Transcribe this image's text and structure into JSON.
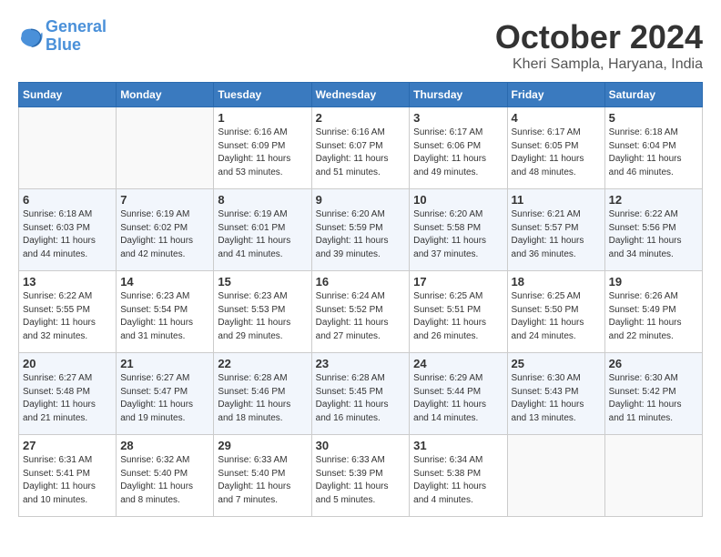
{
  "header": {
    "logo_line1": "General",
    "logo_line2": "Blue",
    "month_title": "October 2024",
    "location": "Kheri Sampla, Haryana, India"
  },
  "days_of_week": [
    "Sunday",
    "Monday",
    "Tuesday",
    "Wednesday",
    "Thursday",
    "Friday",
    "Saturday"
  ],
  "weeks": [
    [
      {
        "day": null
      },
      {
        "day": null
      },
      {
        "day": "1",
        "sunrise": "6:16 AM",
        "sunset": "6:09 PM",
        "daylight": "11 hours and 53 minutes."
      },
      {
        "day": "2",
        "sunrise": "6:16 AM",
        "sunset": "6:07 PM",
        "daylight": "11 hours and 51 minutes."
      },
      {
        "day": "3",
        "sunrise": "6:17 AM",
        "sunset": "6:06 PM",
        "daylight": "11 hours and 49 minutes."
      },
      {
        "day": "4",
        "sunrise": "6:17 AM",
        "sunset": "6:05 PM",
        "daylight": "11 hours and 48 minutes."
      },
      {
        "day": "5",
        "sunrise": "6:18 AM",
        "sunset": "6:04 PM",
        "daylight": "11 hours and 46 minutes."
      }
    ],
    [
      {
        "day": "6",
        "sunrise": "6:18 AM",
        "sunset": "6:03 PM",
        "daylight": "11 hours and 44 minutes."
      },
      {
        "day": "7",
        "sunrise": "6:19 AM",
        "sunset": "6:02 PM",
        "daylight": "11 hours and 42 minutes."
      },
      {
        "day": "8",
        "sunrise": "6:19 AM",
        "sunset": "6:01 PM",
        "daylight": "11 hours and 41 minutes."
      },
      {
        "day": "9",
        "sunrise": "6:20 AM",
        "sunset": "5:59 PM",
        "daylight": "11 hours and 39 minutes."
      },
      {
        "day": "10",
        "sunrise": "6:20 AM",
        "sunset": "5:58 PM",
        "daylight": "11 hours and 37 minutes."
      },
      {
        "day": "11",
        "sunrise": "6:21 AM",
        "sunset": "5:57 PM",
        "daylight": "11 hours and 36 minutes."
      },
      {
        "day": "12",
        "sunrise": "6:22 AM",
        "sunset": "5:56 PM",
        "daylight": "11 hours and 34 minutes."
      }
    ],
    [
      {
        "day": "13",
        "sunrise": "6:22 AM",
        "sunset": "5:55 PM",
        "daylight": "11 hours and 32 minutes."
      },
      {
        "day": "14",
        "sunrise": "6:23 AM",
        "sunset": "5:54 PM",
        "daylight": "11 hours and 31 minutes."
      },
      {
        "day": "15",
        "sunrise": "6:23 AM",
        "sunset": "5:53 PM",
        "daylight": "11 hours and 29 minutes."
      },
      {
        "day": "16",
        "sunrise": "6:24 AM",
        "sunset": "5:52 PM",
        "daylight": "11 hours and 27 minutes."
      },
      {
        "day": "17",
        "sunrise": "6:25 AM",
        "sunset": "5:51 PM",
        "daylight": "11 hours and 26 minutes."
      },
      {
        "day": "18",
        "sunrise": "6:25 AM",
        "sunset": "5:50 PM",
        "daylight": "11 hours and 24 minutes."
      },
      {
        "day": "19",
        "sunrise": "6:26 AM",
        "sunset": "5:49 PM",
        "daylight": "11 hours and 22 minutes."
      }
    ],
    [
      {
        "day": "20",
        "sunrise": "6:27 AM",
        "sunset": "5:48 PM",
        "daylight": "11 hours and 21 minutes."
      },
      {
        "day": "21",
        "sunrise": "6:27 AM",
        "sunset": "5:47 PM",
        "daylight": "11 hours and 19 minutes."
      },
      {
        "day": "22",
        "sunrise": "6:28 AM",
        "sunset": "5:46 PM",
        "daylight": "11 hours and 18 minutes."
      },
      {
        "day": "23",
        "sunrise": "6:28 AM",
        "sunset": "5:45 PM",
        "daylight": "11 hours and 16 minutes."
      },
      {
        "day": "24",
        "sunrise": "6:29 AM",
        "sunset": "5:44 PM",
        "daylight": "11 hours and 14 minutes."
      },
      {
        "day": "25",
        "sunrise": "6:30 AM",
        "sunset": "5:43 PM",
        "daylight": "11 hours and 13 minutes."
      },
      {
        "day": "26",
        "sunrise": "6:30 AM",
        "sunset": "5:42 PM",
        "daylight": "11 hours and 11 minutes."
      }
    ],
    [
      {
        "day": "27",
        "sunrise": "6:31 AM",
        "sunset": "5:41 PM",
        "daylight": "11 hours and 10 minutes."
      },
      {
        "day": "28",
        "sunrise": "6:32 AM",
        "sunset": "5:40 PM",
        "daylight": "11 hours and 8 minutes."
      },
      {
        "day": "29",
        "sunrise": "6:33 AM",
        "sunset": "5:40 PM",
        "daylight": "11 hours and 7 minutes."
      },
      {
        "day": "30",
        "sunrise": "6:33 AM",
        "sunset": "5:39 PM",
        "daylight": "11 hours and 5 minutes."
      },
      {
        "day": "31",
        "sunrise": "6:34 AM",
        "sunset": "5:38 PM",
        "daylight": "11 hours and 4 minutes."
      },
      {
        "day": null
      },
      {
        "day": null
      }
    ]
  ],
  "labels": {
    "sunrise": "Sunrise:",
    "sunset": "Sunset:",
    "daylight": "Daylight:"
  }
}
